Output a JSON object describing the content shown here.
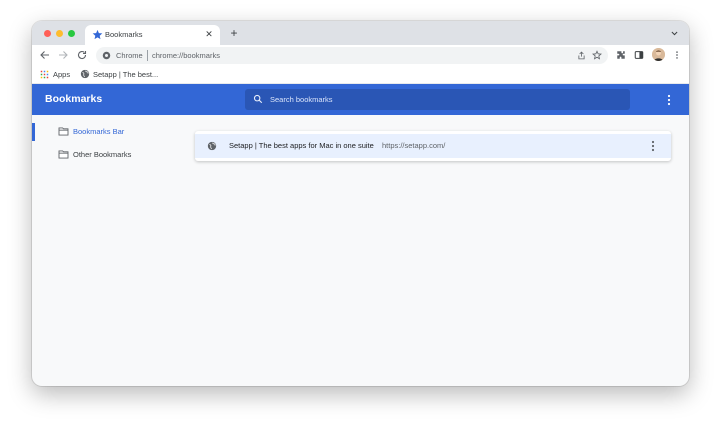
{
  "tab": {
    "title": "Bookmarks",
    "icon": "star-icon"
  },
  "omnibox": {
    "scheme_label": "Chrome",
    "url": "chrome://bookmarks"
  },
  "bookmarks_bar": {
    "items": [
      {
        "label": "Apps",
        "icon": "apps-grid-icon"
      },
      {
        "label": "Setapp | The best...",
        "icon": "globe-icon"
      }
    ]
  },
  "header": {
    "title": "Bookmarks",
    "search_placeholder": "Search bookmarks"
  },
  "sidebar": {
    "items": [
      {
        "label": "Bookmarks Bar",
        "selected": true,
        "icon": "folder-icon"
      },
      {
        "label": "Other Bookmarks",
        "selected": false,
        "icon": "folder-icon"
      }
    ]
  },
  "bookmark_list": [
    {
      "title": "Setapp | The best apps for Mac in one suite",
      "url": "https://setapp.com/",
      "icon": "globe-icon"
    }
  ],
  "colors": {
    "accent": "#3367d6",
    "header_search_bg": "#2a56b5",
    "selected_row_bg": "#e8f0fe",
    "tab_strip_bg": "#dee1e6"
  }
}
